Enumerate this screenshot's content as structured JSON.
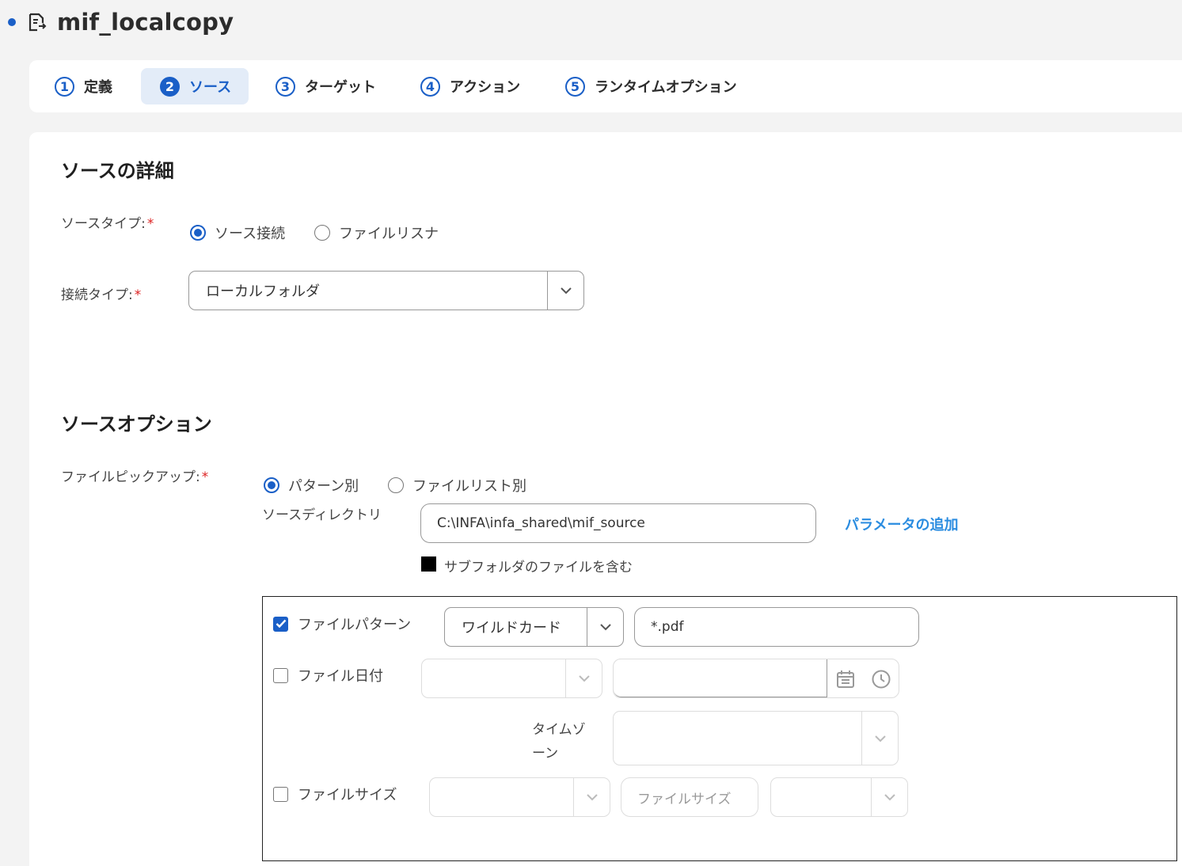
{
  "header": {
    "title": "mif_localcopy"
  },
  "tabs": [
    {
      "num": "1",
      "label": "定義"
    },
    {
      "num": "2",
      "label": "ソース"
    },
    {
      "num": "3",
      "label": "ターゲット"
    },
    {
      "num": "4",
      "label": "アクション"
    },
    {
      "num": "5",
      "label": "ランタイムオプション"
    }
  ],
  "active_tab": 1,
  "source_details": {
    "heading": "ソースの詳細",
    "source_type_label": "ソースタイプ:",
    "source_type_options": [
      "ソース接続",
      "ファイルリスナ"
    ],
    "source_type_selected": "ソース接続",
    "connection_type_label": "接続タイプ:",
    "connection_type_value": "ローカルフォルダ"
  },
  "source_options": {
    "heading": "ソースオプション",
    "file_pickup_label": "ファイルピックアップ:",
    "file_pickup_options": [
      "パターン別",
      "ファイルリスト別"
    ],
    "file_pickup_selected": "パターン別",
    "source_dir_label": "ソースディレクトリ",
    "source_dir_value": "C:\\INFA\\infa_shared\\mif_source",
    "add_param_link": "パラメータの追加",
    "include_subfolders_label": "サブフォルダのファイルを含む"
  },
  "filters": {
    "file_pattern": {
      "label": "ファイルパターン",
      "checked": true,
      "type_value": "ワイルドカード",
      "pattern_value": "*.pdf"
    },
    "file_date": {
      "label": "ファイル日付",
      "checked": false,
      "timezone_label_1": "タイムゾ",
      "timezone_label_2": "ーン"
    },
    "file_size": {
      "label": "ファイルサイズ",
      "checked": false,
      "size_placeholder": "ファイルサイズ"
    }
  },
  "colors": {
    "accent": "#1a5fc7",
    "link": "#2a8ce0",
    "required": "#d22222"
  }
}
